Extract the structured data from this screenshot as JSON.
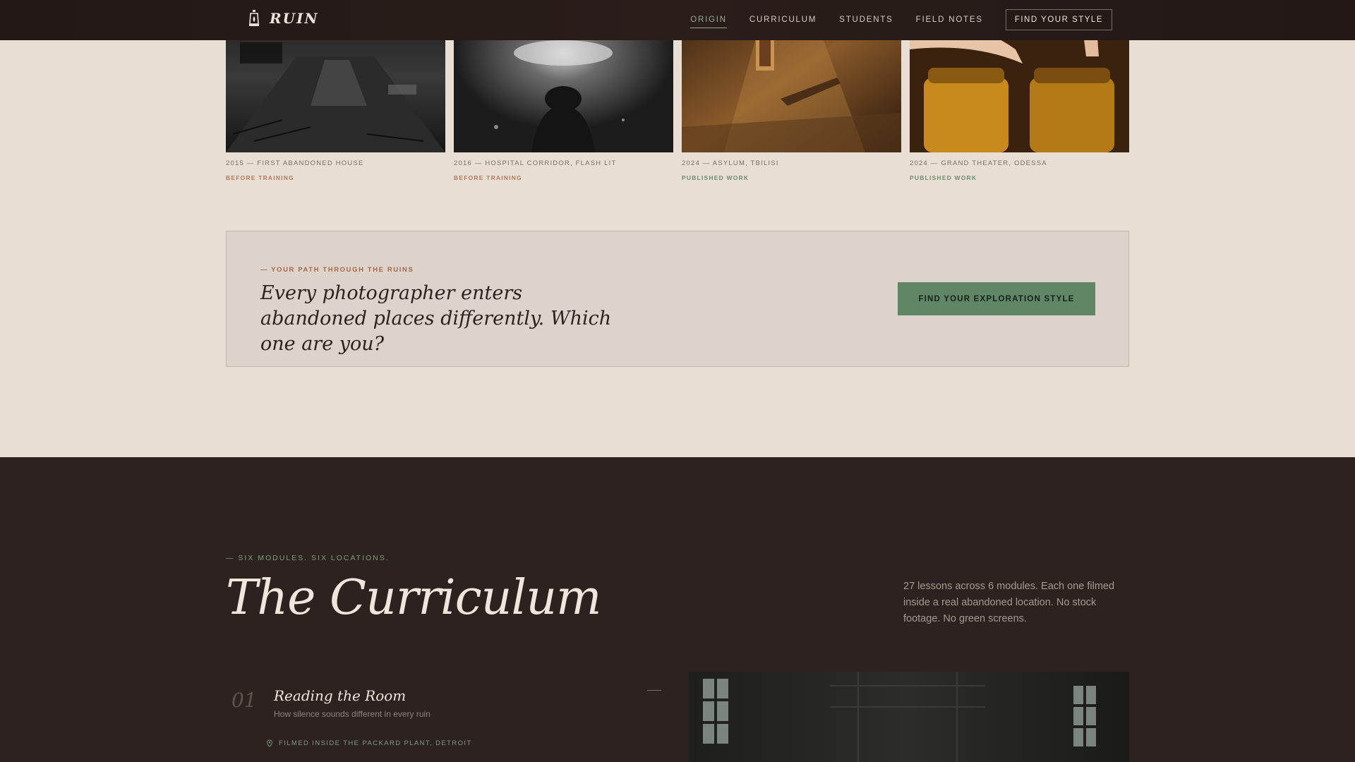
{
  "nav": {
    "brand": "RUIN",
    "links": [
      {
        "label": "ORIGIN"
      },
      {
        "label": "CURRICULUM"
      },
      {
        "label": "STUDENTS"
      },
      {
        "label": "FIELD NOTES"
      }
    ],
    "active": "ORIGIN",
    "cta": "FIND YOUR STYLE"
  },
  "gallery": {
    "items": [
      {
        "caption": "2015 — FIRST ABANDONED HOUSE",
        "status": "BEFORE TRAINING"
      },
      {
        "caption": "2016 — HOSPITAL CORRIDOR, FLASH LIT",
        "status": "BEFORE TRAINING"
      },
      {
        "caption": "2024 — ASYLUM, TBILISI",
        "status": "PUBLISHED WORK"
      },
      {
        "caption": "2024 — GRAND THEATER, ODESSA",
        "status": "PUBLISHED WORK"
      }
    ]
  },
  "cta": {
    "eyebrow": "— YOUR PATH THROUGH THE RUINS",
    "headline": "Every photographer enters abandoned places differently. Which one are you?",
    "button": "FIND YOUR EXPLORATION STYLE"
  },
  "curriculum": {
    "eyebrow": "— SIX MODULES. SIX LOCATIONS.",
    "title": "The Curriculum",
    "description": "27 lessons across 6 modules. Each one filmed inside a real abandoned location. No stock footage. No green screens.",
    "modules": [
      {
        "number": "01",
        "title": "Reading the Room",
        "subtitle": "How silence sounds different in every ruin",
        "location": "FILMED INSIDE THE PACKARD PLANT, DETROIT"
      }
    ]
  },
  "colors": {
    "page_bg": "#e8ded3",
    "nav_bg": "#231917",
    "dark_bg": "#2c2320",
    "accent_green": "#5f8767",
    "accent_rust": "#a36a4a"
  }
}
